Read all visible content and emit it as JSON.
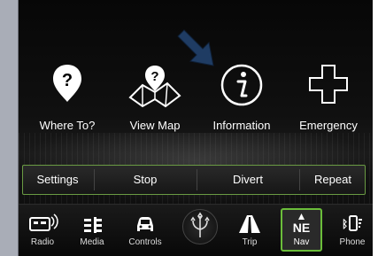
{
  "main_menu": {
    "items": [
      {
        "label": "Where To?",
        "icon": "map-pin-icon"
      },
      {
        "label": "View Map",
        "icon": "folded-map-icon"
      },
      {
        "label": "Information",
        "icon": "info-icon"
      },
      {
        "label": "Emergency",
        "icon": "medical-cross-icon"
      }
    ],
    "highlight_icon": "pointer-arrow-icon"
  },
  "soft_buttons": [
    {
      "label": "Settings"
    },
    {
      "label": "Stop"
    },
    {
      "label": "Divert"
    },
    {
      "label": "Repeat"
    }
  ],
  "bottom_bar": {
    "items": [
      {
        "label": "Radio",
        "icon": "radio-icon"
      },
      {
        "label": "Media",
        "icon": "media-icon"
      },
      {
        "label": "Controls",
        "icon": "car-icon"
      },
      {
        "label": "",
        "icon": "trident-logo"
      },
      {
        "label": "Trip",
        "icon": "road-icon"
      },
      {
        "label": "Nav",
        "icon": "compass-icon",
        "heading": "NE",
        "active": true
      },
      {
        "label": "Phone",
        "icon": "phone-icon"
      }
    ]
  },
  "colors": {
    "accent_green": "#6bbd3a",
    "arrow_blue": "#1f3c63",
    "background": "#0b0b0b"
  }
}
